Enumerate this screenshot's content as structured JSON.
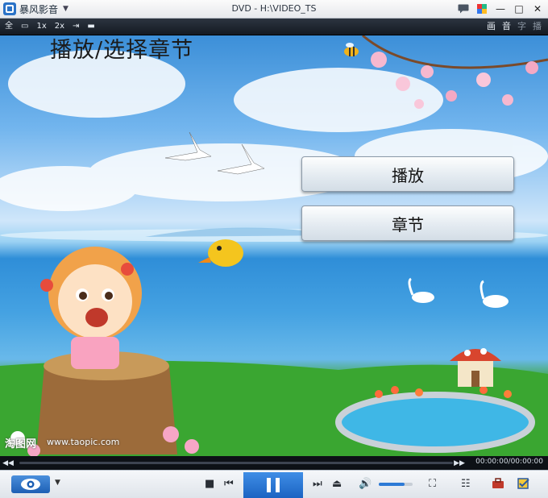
{
  "app": {
    "name": "暴风影音",
    "window_title": "DVD - H:\\VIDEO_TS"
  },
  "window_controls": {
    "chat_icon": "speech-bubble-icon",
    "skin_icon": "palette-icon",
    "minimize": "—",
    "maximize": "□",
    "close": "✕"
  },
  "toolbar": {
    "left": [
      "全",
      "▭",
      "1x",
      "2x",
      "⇥",
      "▬"
    ],
    "right": [
      "画",
      "音",
      "字",
      "播"
    ]
  },
  "dvd_menu": {
    "title": "播放/选择章节",
    "buttons": [
      "播放",
      "章节"
    ]
  },
  "watermark": {
    "brand": "淘图网",
    "url": "www.taopic.com"
  },
  "seek": {
    "prev": "◀◀",
    "next": "▶▶",
    "time": "00:00:00/00:00:00",
    "progress": 0
  },
  "controls": {
    "stop": "■",
    "prev": "⏮",
    "next": "⏭",
    "eject": "⏏",
    "volume_icon": "🔊",
    "volume_level": 0.75,
    "screen_icon": "⛶",
    "list_icon": "☷",
    "box_icon": "toolbox-icon",
    "check_icon": "checkbox-icon"
  }
}
